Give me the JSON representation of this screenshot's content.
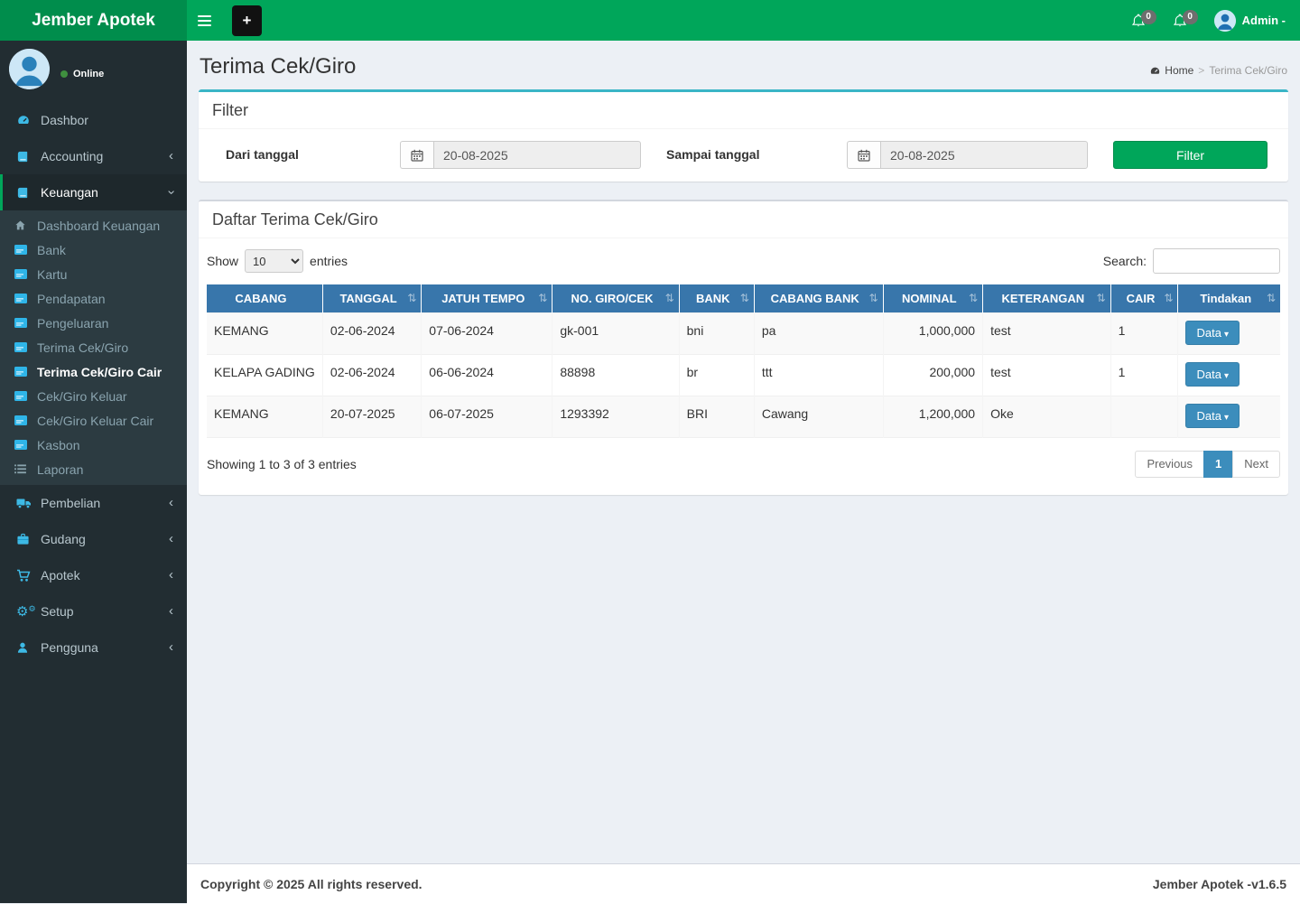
{
  "colors": {
    "navbar_green": "#00a65a",
    "logo_green": "#008d4c",
    "sidebar_dark": "#222d32",
    "submenu_dark": "#2c3b41",
    "active_accent_green": "#00a65a",
    "filter_box_top_border": "#3ab5c6",
    "table_header_blue": "#3876ab",
    "primary_button_blue": "#3c8dbc",
    "filter_button_green": "#00a65a"
  },
  "header": {
    "logo": "Jember Apotek",
    "user": "Admin -",
    "notif1_count": "0",
    "notif2_count": "0"
  },
  "sidebar": {
    "status": "Online",
    "menu": [
      {
        "label": "Dashbor",
        "icon": "tachometer-icon"
      },
      {
        "label": "Accounting",
        "icon": "book-icon",
        "chevron": "left"
      },
      {
        "label": "Keuangan",
        "icon": "book-icon",
        "chevron": "down",
        "active": true,
        "children": [
          {
            "label": "Dashboard Keuangan",
            "icon": "home-icon"
          },
          {
            "label": "Bank",
            "icon": "credit-card-icon"
          },
          {
            "label": "Kartu",
            "icon": "credit-card-icon"
          },
          {
            "label": "Pendapatan",
            "icon": "credit-card-icon"
          },
          {
            "label": "Pengeluaran",
            "icon": "credit-card-icon"
          },
          {
            "label": "Terima Cek/Giro",
            "icon": "credit-card-icon"
          },
          {
            "label": "Terima Cek/Giro Cair",
            "icon": "credit-card-icon",
            "active": true
          },
          {
            "label": "Cek/Giro Keluar",
            "icon": "credit-card-icon"
          },
          {
            "label": "Cek/Giro Keluar Cair",
            "icon": "credit-card-icon"
          },
          {
            "label": "Kasbon",
            "icon": "credit-card-icon"
          },
          {
            "label": "Laporan",
            "icon": "list-icon"
          }
        ]
      },
      {
        "label": "Pembelian",
        "icon": "truck-icon",
        "chevron": "left"
      },
      {
        "label": "Gudang",
        "icon": "briefcase-icon",
        "chevron": "left"
      },
      {
        "label": "Apotek",
        "icon": "cart-icon",
        "chevron": "left"
      },
      {
        "label": "Setup",
        "icon": "gears-icon",
        "chevron": "left"
      },
      {
        "label": "Pengguna",
        "icon": "user-icon",
        "chevron": "left"
      }
    ]
  },
  "page": {
    "title": "Terima Cek/Giro",
    "breadcrumb": {
      "home": "Home",
      "sep": ">",
      "current": "Terima Cek/Giro"
    }
  },
  "filter": {
    "box_title": "Filter",
    "from_label": "Dari tanggal",
    "from_value": "20-08-2025",
    "to_label": "Sampai tanggal",
    "to_value": "20-08-2025",
    "submit_label": "Filter"
  },
  "table": {
    "box_title": "Daftar Terima Cek/Giro",
    "show_label": "Show",
    "page_length": "10",
    "entries_label": "entries",
    "search_label": "Search:",
    "columns": [
      "CABANG",
      "TANGGAL",
      "JATUH TEMPO",
      "NO. GIRO/CEK",
      "BANK",
      "CABANG BANK",
      "NOMINAL",
      "KETERANGAN",
      "CAIR",
      "Tindakan"
    ],
    "action_label": "Data",
    "rows": [
      {
        "cabang": "KEMANG",
        "tanggal": "02-06-2024",
        "jatuh_tempo": "07-06-2024",
        "no_giro": "gk-001",
        "bank": "bni",
        "cabang_bank": "pa",
        "nominal": "1,000,000",
        "keterangan": "test",
        "cair": "1"
      },
      {
        "cabang": "KELAPA GADING",
        "tanggal": "02-06-2024",
        "jatuh_tempo": "06-06-2024",
        "no_giro": "88898",
        "bank": "br",
        "cabang_bank": "ttt",
        "nominal": "200,000",
        "keterangan": "test",
        "cair": "1"
      },
      {
        "cabang": "KEMANG",
        "tanggal": "20-07-2025",
        "jatuh_tempo": "06-07-2025",
        "no_giro": "1293392",
        "bank": "BRI",
        "cabang_bank": "Cawang",
        "nominal": "1,200,000",
        "keterangan": "Oke",
        "cair": ""
      }
    ],
    "info": "Showing 1 to 3 of 3 entries",
    "pagination": {
      "previous": "Previous",
      "current": "1",
      "next": "Next"
    }
  },
  "footer": {
    "left": "Copyright © 2025 All rights reserved.",
    "right": "Jember Apotek -v1.6.5"
  },
  "icons": {
    "plus": "+",
    "sort": "⇅",
    "caret_down": "▾",
    "chevron_collapsed": "‹"
  }
}
